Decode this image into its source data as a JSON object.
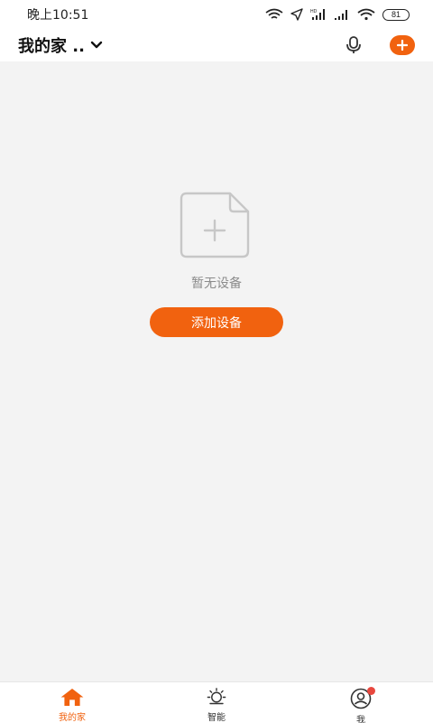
{
  "status_bar": {
    "time": "晚上10:51",
    "battery": "81"
  },
  "header": {
    "home_name": "我的家 ..",
    "icons": [
      "chevron-down-icon",
      "microphone-icon",
      "plus-icon"
    ]
  },
  "empty_state": {
    "icon": "add-file-icon",
    "message": "暂无设备",
    "button_label": "添加设备"
  },
  "bottom_nav": {
    "items": [
      {
        "label": "我的家",
        "icon": "home-icon",
        "active": true
      },
      {
        "label": "智能",
        "icon": "sun-icon",
        "active": false
      },
      {
        "label": "我",
        "icon": "profile-icon",
        "active": false
      }
    ]
  },
  "colors": {
    "accent": "#f1620f",
    "background": "#f3f3f3",
    "badge": "#e8473e"
  }
}
